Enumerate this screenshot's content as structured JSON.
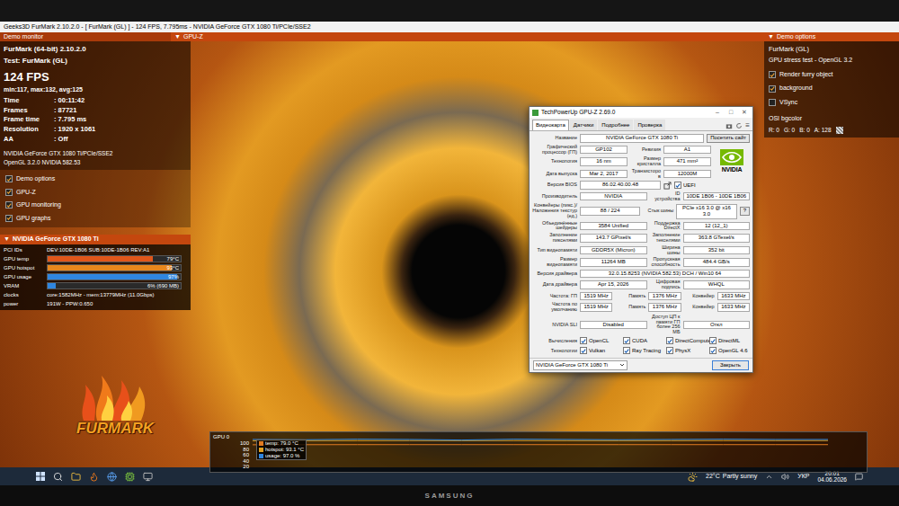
{
  "window": {
    "title": "Geeks3D FurMark 2.10.2.0 - [ FurMark (GL) ] - 124 FPS, 7.795ms - NVIDIA GeForce GTX 1080 Ti/PCIe/SSE2"
  },
  "header": {
    "left": "Demo monitor",
    "center": "GPU-Z",
    "right": "Demo options",
    "arrow": "▼"
  },
  "demo_monitor": {
    "app": "FurMark (64-bit) 2.10.2.0",
    "test": "Test: FurMark (GL)",
    "fps": "124 FPS",
    "stats": "min:117, max:132, avg:125",
    "info": [
      {
        "label": "Time",
        "value": ": 00:11:42"
      },
      {
        "label": "Frames",
        "value": ": 87721"
      },
      {
        "label": "Frame time",
        "value": ": 7.795 ms"
      },
      {
        "label": "Resolution",
        "value": ": 1920 x 1061"
      },
      {
        "label": "AA",
        "value": ": Off"
      }
    ],
    "gpu_name": "NVIDIA GeForce GTX 1080 Ti/PCIe/SSE2",
    "opengl": "OpenGL 3.2.0 NVIDIA 582.53",
    "toggles": [
      {
        "label": "Demo options",
        "checked": true
      },
      {
        "label": "GPU-Z",
        "checked": true
      },
      {
        "label": "GPU monitoring",
        "checked": true
      },
      {
        "label": "GPU graphs",
        "checked": true
      }
    ]
  },
  "gpu_panel": {
    "title": "NVIDIA GeForce GTX 1080 Ti",
    "pci_label": "PCI IDs",
    "pci": "DEV:10DE-1B06 SUB:10DE-1B06 REV:A1",
    "meters": [
      {
        "label": "GPU temp",
        "reading": "79°C",
        "level": 0.79,
        "color": "#e0561a"
      },
      {
        "label": "GPU hotspot",
        "reading": "93°C",
        "level": 0.93,
        "color": "#e8871c"
      },
      {
        "label": "GPU usage",
        "reading": "97%",
        "level": 0.97,
        "color": "#2f86e0"
      },
      {
        "label": "VRAM",
        "reading": "6% (690 MB)",
        "level": 0.06,
        "color": "#2f86e0"
      }
    ],
    "details": [
      {
        "label": "clocks",
        "value": "core:1582MHz - mem:13779MHz (11.0Gbps)"
      },
      {
        "label": "power",
        "value": "191W - PPW:0.650"
      }
    ]
  },
  "demo_options": {
    "title": "FurMark (GL)",
    "subtitle": "GPU stress test - OpenGL 3.2",
    "toggles": [
      {
        "label": "Render furry object",
        "checked": true
      },
      {
        "label": "background",
        "checked": true
      },
      {
        "label": "VSync",
        "checked": false
      }
    ],
    "bgcolor_label": "OSI bgcolor",
    "channels": [
      "R: 0",
      "G: 0",
      "B: 0",
      "A: 128"
    ]
  },
  "gpuz": {
    "title": "TechPowerUp GPU-Z 2.69.0",
    "controls": [
      "–",
      "□",
      "✕"
    ],
    "menu": "≡",
    "tabs": [
      {
        "label": "Видеокарта",
        "selected": true
      },
      {
        "label": "Датчики",
        "selected": false
      },
      {
        "label": "Подробнее",
        "selected": false
      },
      {
        "label": "Проверка",
        "selected": false
      }
    ],
    "logo": "NVIDIA",
    "rows_top": [
      {
        "label": "Название",
        "items": [
          {
            "kind": "value",
            "text": "NVIDIA GeForce GTX 1080 Ti"
          },
          {
            "kind": "button",
            "text": "Посетить сайт"
          }
        ]
      }
    ],
    "rows_logo": [
      {
        "label": "Графический процессор (ГП)",
        "items": [
          {
            "kind": "value",
            "text": "GP102"
          },
          {
            "kind": "label",
            "text": "Ревизия"
          },
          {
            "kind": "value",
            "text": "A1"
          }
        ]
      },
      {
        "label": "Технология",
        "items": [
          {
            "kind": "value",
            "text": "16 nm"
          },
          {
            "kind": "label",
            "text": "Размер кристалла"
          },
          {
            "kind": "value",
            "text": "471 mm²"
          }
        ]
      },
      {
        "label": "Дата выпуска",
        "items": [
          {
            "kind": "value",
            "text": "Mar 2, 2017"
          },
          {
            "kind": "label",
            "text": "Транзисторов"
          },
          {
            "kind": "value",
            "text": "12000M"
          }
        ]
      }
    ],
    "rows": [
      {
        "label": "Версия BIOS",
        "items": [
          {
            "kind": "value",
            "text": "86.02.40.00.48"
          },
          {
            "kind": "share",
            "text": ""
          },
          {
            "kind": "check",
            "text": "UEFI",
            "checked": true
          }
        ]
      },
      {
        "label": "Производитель",
        "items": [
          {
            "kind": "value",
            "text": "NVIDIA"
          },
          {
            "kind": "label",
            "text": "ID устройства"
          },
          {
            "kind": "value",
            "text": "10DE 1B06 - 10DE 1B06"
          }
        ]
      },
      {
        "label": "Конвейеры (пикс.)/ Наложения текстур (ед.)",
        "items": [
          {
            "kind": "value",
            "text": "88 / 224"
          },
          {
            "kind": "label",
            "text": "Стык шины"
          },
          {
            "kind": "value",
            "text": "PCIe x16 3.0 @ x16 3.0"
          },
          {
            "kind": "button",
            "text": "?"
          }
        ]
      },
      {
        "label": "Объединённые шейдеры",
        "items": [
          {
            "kind": "value",
            "text": "3584 Unified"
          },
          {
            "kind": "label",
            "text": "Поддержка DirectX"
          },
          {
            "kind": "value",
            "text": "12 (12_1)"
          }
        ]
      },
      {
        "label": "Заполнение пикселями",
        "items": [
          {
            "kind": "value",
            "text": "143.7 GPixel/s"
          },
          {
            "kind": "label",
            "text": "Заполнение текселями"
          },
          {
            "kind": "value",
            "text": "363.8 GTexel/s"
          }
        ]
      },
      {
        "label": "Тип видеопамяти",
        "items": [
          {
            "kind": "value",
            "text": "GDDR5X (Micron)"
          },
          {
            "kind": "label",
            "text": "Ширина шины"
          },
          {
            "kind": "value",
            "text": "352 bit"
          }
        ]
      },
      {
        "label": "Размер видеопамяти",
        "items": [
          {
            "kind": "value",
            "text": "11264 MB"
          },
          {
            "kind": "label",
            "text": "Пропускная способность"
          },
          {
            "kind": "value",
            "text": "484.4 GB/s"
          }
        ]
      },
      {
        "label": "Версия драйвера",
        "items": [
          {
            "kind": "value",
            "text": "32.0.15.8253 (NVIDIA 582.53) DCH / Win10 64"
          }
        ]
      },
      {
        "label": "Дата драйвера",
        "items": [
          {
            "kind": "value",
            "text": "Apr 15, 2026"
          },
          {
            "kind": "label",
            "text": "Цифровая подпись"
          },
          {
            "kind": "value",
            "text": "WHQL"
          }
        ]
      },
      {
        "label": "Частота: ГП",
        "items": [
          {
            "kind": "value",
            "text": "1519 MHz"
          },
          {
            "kind": "label",
            "text": "Память"
          },
          {
            "kind": "value",
            "text": "1376 MHz"
          },
          {
            "kind": "label",
            "text": "Конвейер"
          },
          {
            "kind": "value",
            "text": "1633 MHz"
          }
        ]
      },
      {
        "label": "Частота по умолчанию",
        "items": [
          {
            "kind": "value",
            "text": "1519 MHz"
          },
          {
            "kind": "label",
            "text": "Память"
          },
          {
            "kind": "value",
            "text": "1376 MHz"
          },
          {
            "kind": "label",
            "text": "Конвейер"
          },
          {
            "kind": "value",
            "text": "1633 MHz"
          }
        ]
      },
      {
        "label": "NVIDIA SLI",
        "items": [
          {
            "kind": "value",
            "text": "Disabled"
          },
          {
            "kind": "label",
            "text": "Доступ ЦП к памяти ГП более 256 МБ"
          },
          {
            "kind": "value",
            "text": "Откл"
          }
        ]
      },
      {
        "label": "Вычисления",
        "items": [
          {
            "kind": "check",
            "text": "OpenCL",
            "checked": true
          },
          {
            "kind": "check",
            "text": "CUDA",
            "checked": true
          },
          {
            "kind": "check",
            "text": "DirectCompute",
            "checked": true
          },
          {
            "kind": "check",
            "text": "DirectML",
            "checked": true
          }
        ]
      },
      {
        "label": "Технологии",
        "items": [
          {
            "kind": "check",
            "text": "Vulkan",
            "checked": true
          },
          {
            "kind": "check",
            "text": "Ray Tracing",
            "checked": true
          },
          {
            "kind": "check",
            "text": "PhysX",
            "checked": true
          },
          {
            "kind": "check",
            "text": "OpenGL 4.6",
            "checked": true
          }
        ]
      }
    ],
    "footer": {
      "select": "NVIDIA GeForce GTX 1080 Ti",
      "button": "Закрыть"
    }
  },
  "graph": {
    "title": "GPU 0",
    "ticks": [
      "100",
      "80",
      "60",
      "40",
      "20"
    ],
    "series": [
      {
        "label": "temp: 79.0 °C",
        "color": "#e07a20",
        "values": [
          78.5,
          78.8,
          79,
          79,
          79,
          79,
          79,
          79,
          79,
          79,
          79,
          79
        ]
      },
      {
        "label": "hotspot: 93.1 °C",
        "color": "#e0a020",
        "values": [
          92.5,
          93,
          93,
          93.1,
          93,
          93.1,
          93,
          93.1,
          93,
          93.1,
          93,
          93.1
        ]
      },
      {
        "label": "usage: 97.0 %",
        "color": "#2f86e0",
        "values": [
          97,
          96,
          98,
          97,
          95,
          98,
          97,
          96,
          97,
          98,
          97,
          97
        ]
      }
    ]
  },
  "logo": {
    "text": "FURMARK"
  },
  "taskbar": {
    "weather": "22°C",
    "weather_text": "Partly sunny",
    "language": "УКР",
    "time": "20:01",
    "date": "04.06.2026"
  },
  "bezel": {
    "brand": "SAMSUNG"
  }
}
